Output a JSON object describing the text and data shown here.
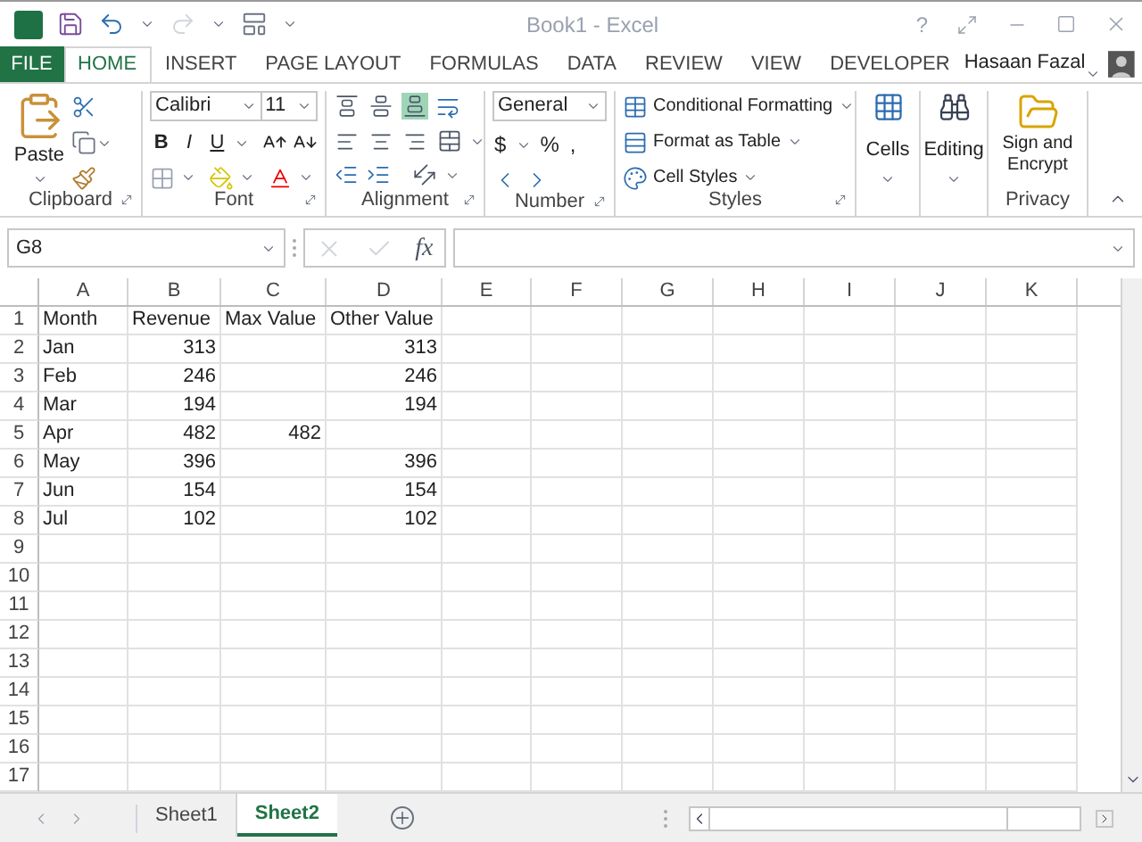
{
  "window": {
    "title": "Book1 - Excel",
    "controls": [
      "?"
    ]
  },
  "tabs": [
    {
      "label": "FILE",
      "kind": "file",
      "selected": false
    },
    {
      "label": "HOME",
      "kind": "tab",
      "selected": true
    },
    {
      "label": "INSERT",
      "kind": "tab",
      "selected": false
    },
    {
      "label": "PAGE LAYOUT",
      "kind": "tab",
      "selected": false
    },
    {
      "label": "FORMULAS",
      "kind": "tab",
      "selected": false
    },
    {
      "label": "DATA",
      "kind": "tab",
      "selected": false
    },
    {
      "label": "REVIEW",
      "kind": "tab",
      "selected": false
    },
    {
      "label": "VIEW",
      "kind": "tab",
      "selected": false
    },
    {
      "label": "DEVELOPER",
      "kind": "tab",
      "selected": false
    }
  ],
  "user": {
    "name": "Hasaan Fazal"
  },
  "ribbon": {
    "clipboard": {
      "label": "Clipboard",
      "paste": "Paste"
    },
    "font": {
      "label": "Font",
      "name": "Calibri",
      "size": "11",
      "styles": [
        "B",
        "I",
        "U"
      ]
    },
    "alignment": {
      "label": "Alignment",
      "vertical": [
        {
          "selected": false
        },
        {
          "selected": false
        },
        {
          "selected": true
        }
      ]
    },
    "number": {
      "label": "Number",
      "format": "General",
      "symbols": [
        "$",
        "%",
        ","
      ]
    },
    "styles": {
      "label": "Styles",
      "items": [
        "Conditional Formatting",
        "Format as Table",
        "Cell Styles"
      ]
    },
    "cells": {
      "label": "Cells"
    },
    "editing": {
      "label": "Editing"
    },
    "privacy": {
      "label": "Privacy",
      "button": "Sign and Encrypt"
    }
  },
  "formula_bar": {
    "name_box": "G8",
    "function_label": "fx"
  },
  "sheet": {
    "columns": [
      "A",
      "B",
      "C",
      "D",
      "E",
      "F",
      "G",
      "H",
      "I",
      "J",
      "K"
    ],
    "rows": [
      {
        "number": "1",
        "cells": [
          {
            "text": "Month",
            "kind": "text"
          },
          {
            "text": "Revenue",
            "kind": "text"
          },
          {
            "text": "Max Value",
            "kind": "text"
          },
          {
            "text": "Other Value",
            "kind": "text"
          }
        ]
      },
      {
        "number": "2",
        "cells": [
          {
            "text": "Jan",
            "kind": "text"
          },
          {
            "text": "313",
            "kind": "number"
          },
          null,
          {
            "text": "313",
            "kind": "number"
          }
        ]
      },
      {
        "number": "3",
        "cells": [
          {
            "text": "Feb",
            "kind": "text"
          },
          {
            "text": "246",
            "kind": "number"
          },
          null,
          {
            "text": "246",
            "kind": "number"
          }
        ]
      },
      {
        "number": "4",
        "cells": [
          {
            "text": "Mar",
            "kind": "text"
          },
          {
            "text": "194",
            "kind": "number"
          },
          null,
          {
            "text": "194",
            "kind": "number"
          }
        ]
      },
      {
        "number": "5",
        "cells": [
          {
            "text": "Apr",
            "kind": "text"
          },
          {
            "text": "482",
            "kind": "number"
          },
          {
            "text": "482",
            "kind": "number"
          },
          null
        ]
      },
      {
        "number": "6",
        "cells": [
          {
            "text": "May",
            "kind": "text"
          },
          {
            "text": "396",
            "kind": "number"
          },
          null,
          {
            "text": "396",
            "kind": "number"
          }
        ]
      },
      {
        "number": "7",
        "cells": [
          {
            "text": "Jun",
            "kind": "text"
          },
          {
            "text": "154",
            "kind": "number"
          },
          null,
          {
            "text": "154",
            "kind": "number"
          }
        ]
      },
      {
        "number": "8",
        "cells": [
          {
            "text": "Jul",
            "kind": "text"
          },
          {
            "text": "102",
            "kind": "number"
          },
          null,
          {
            "text": "102",
            "kind": "number"
          }
        ]
      },
      {
        "number": "9",
        "cells": []
      },
      {
        "number": "10",
        "cells": []
      },
      {
        "number": "11",
        "cells": []
      },
      {
        "number": "12",
        "cells": []
      },
      {
        "number": "13",
        "cells": []
      },
      {
        "number": "14",
        "cells": []
      },
      {
        "number": "15",
        "cells": []
      },
      {
        "number": "16",
        "cells": []
      },
      {
        "number": "17",
        "cells": []
      }
    ]
  },
  "sheet_tabs": [
    {
      "label": "Sheet1",
      "selected": false
    },
    {
      "label": "Sheet2",
      "selected": true
    }
  ]
}
